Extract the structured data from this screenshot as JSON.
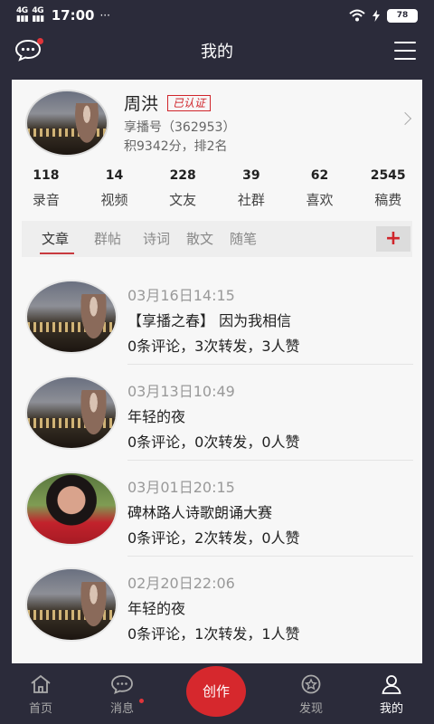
{
  "status_bar": {
    "signal1": "4G",
    "signal2": "4G",
    "time": "17:00",
    "dots": "···",
    "battery": "78"
  },
  "header": {
    "title": "我的"
  },
  "profile": {
    "name": "周洪",
    "verified_badge": "已认证",
    "id_text": "享播号（362953）",
    "score_text": "积9342分，排2名"
  },
  "stats": [
    {
      "num": "118",
      "label": "录音"
    },
    {
      "num": "14",
      "label": "视频"
    },
    {
      "num": "228",
      "label": "文友"
    },
    {
      "num": "39",
      "label": "社群"
    },
    {
      "num": "62",
      "label": "喜欢"
    },
    {
      "num": "2545",
      "label": "稿费"
    }
  ],
  "tabs": [
    "文章",
    "群帖",
    "诗词",
    "散文",
    "随笔"
  ],
  "active_tab": "文章",
  "plus_label": "+",
  "articles": [
    {
      "date": "03月16日14:15",
      "title": "【享播之春】 因为我相信",
      "meta": "0条评论，3次转发，3人赞",
      "avatar": "city-night-man"
    },
    {
      "date": "03月13日10:49",
      "title": "年轻的夜",
      "meta": "0条评论，0次转发，0人赞",
      "avatar": "city-night-man"
    },
    {
      "date": "03月01日20:15",
      "title": "碑林路人诗歌朗诵大赛",
      "meta": "0条评论，2次转发，0人赞",
      "avatar": "girl-red"
    },
    {
      "date": "02月20日22:06",
      "title": "年轻的夜",
      "meta": "0条评论，1次转发，1人赞",
      "avatar": "city-night-man"
    }
  ],
  "bottom_nav": {
    "home": "首页",
    "messages": "消息",
    "create": "创作",
    "discover": "发现",
    "mine": "我的"
  },
  "colors": {
    "background": "#2b2b3a",
    "accent": "#d6282d",
    "card": "#f7f7f7"
  }
}
